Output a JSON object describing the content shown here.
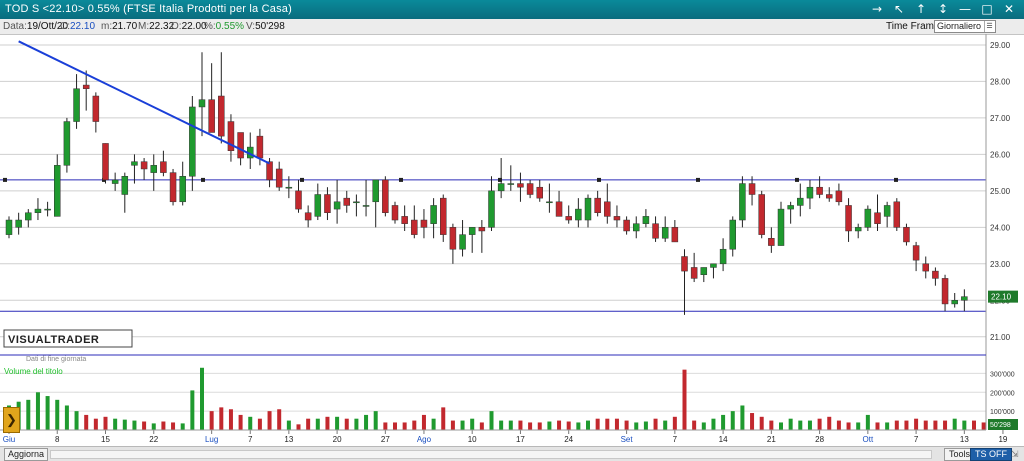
{
  "titlebar": {
    "title": "TOD S <22.10> 0.55%  (FTSE Italia Prodotti per la Casa)",
    "controls": [
      "→",
      "↖",
      "↑",
      "↕",
      "—",
      "□",
      "✕"
    ]
  },
  "info": {
    "date_label": "Data:",
    "date": "19/Ott/20",
    "close_label": "C:",
    "close": "22.10",
    "min_label": "m:",
    "min": "21.70",
    "max_label": "M:",
    "max": "22.32",
    "open_label": "O:",
    "open": "22.00",
    "pct_label": "%:",
    "pct": "0.55%",
    "vol_label": "V:",
    "vol": "50'298"
  },
  "timeframe": {
    "label": "Time Frame",
    "value": "Giornaliero"
  },
  "colors": {
    "up": "#1f9a2f",
    "down": "#c2282e",
    "trendline": "#1a3fd8",
    "level": "#2b2bb8",
    "volume_label": "#1fbf2a",
    "price_badge": "#1f7a2b"
  },
  "watermark": {
    "brand": "VISUALTRADER",
    "note": "Dati di fine giornata"
  },
  "volume_panel": {
    "label": "Volume del titolo",
    "last_value": "50'298"
  },
  "bottombar": {
    "refresh": "Aggiorna",
    "tools": "Tools",
    "ts": "TS OFF"
  },
  "chart_data": [
    {
      "type": "candlestick",
      "title": "",
      "ylim": [
        20.5,
        29.3
      ],
      "yticks": [
        "29.00",
        "28.00",
        "27.00",
        "26.00",
        "25.00",
        "24.00",
        "23.00",
        "22.00",
        "21.00"
      ],
      "last_price": "22.10",
      "x_ticks": [
        "Giu",
        "8",
        "15",
        "22",
        "Lug",
        "7",
        "13",
        "20",
        "27",
        "Ago",
        "10",
        "17",
        "24",
        "Set",
        "7",
        "14",
        "21",
        "28",
        "Ott",
        "7",
        "13",
        "19"
      ],
      "x_tick_index": [
        0,
        5,
        10,
        15,
        21,
        25,
        29,
        34,
        39,
        43,
        48,
        53,
        58,
        64,
        69,
        74,
        79,
        84,
        89,
        94,
        99,
        103
      ],
      "horizontal_levels": [
        25.3,
        21.7
      ],
      "trendline": {
        "from": {
          "index": 1,
          "price": 29.1
        },
        "to": {
          "index": 27,
          "price": 25.75
        }
      },
      "candles": [
        {
          "o": 23.8,
          "h": 24.3,
          "l": 23.7,
          "c": 24.2
        },
        {
          "o": 24.0,
          "h": 24.4,
          "l": 23.8,
          "c": 24.2
        },
        {
          "o": 24.2,
          "h": 24.5,
          "l": 24.0,
          "c": 24.4
        },
        {
          "o": 24.4,
          "h": 24.8,
          "l": 24.2,
          "c": 24.5
        },
        {
          "o": 24.5,
          "h": 24.7,
          "l": 24.3,
          "c": 24.5
        },
        {
          "o": 24.3,
          "h": 26.0,
          "l": 24.3,
          "c": 25.7
        },
        {
          "o": 25.7,
          "h": 27.0,
          "l": 25.5,
          "c": 26.9
        },
        {
          "o": 26.9,
          "h": 28.2,
          "l": 26.7,
          "c": 27.8
        },
        {
          "o": 27.9,
          "h": 28.3,
          "l": 27.2,
          "c": 27.8
        },
        {
          "o": 27.6,
          "h": 27.7,
          "l": 26.6,
          "c": 26.9
        },
        {
          "o": 26.3,
          "h": 26.3,
          "l": 25.2,
          "c": 25.3
        },
        {
          "o": 25.2,
          "h": 25.5,
          "l": 25.0,
          "c": 25.3
        },
        {
          "o": 24.9,
          "h": 25.5,
          "l": 24.4,
          "c": 25.4
        },
        {
          "o": 25.7,
          "h": 26.0,
          "l": 25.2,
          "c": 25.8
        },
        {
          "o": 25.8,
          "h": 25.9,
          "l": 25.3,
          "c": 25.6
        },
        {
          "o": 25.5,
          "h": 26.0,
          "l": 25.0,
          "c": 25.7
        },
        {
          "o": 25.8,
          "h": 26.1,
          "l": 25.4,
          "c": 25.5
        },
        {
          "o": 25.5,
          "h": 25.6,
          "l": 24.6,
          "c": 24.7
        },
        {
          "o": 24.7,
          "h": 25.8,
          "l": 24.6,
          "c": 25.4
        },
        {
          "o": 25.4,
          "h": 27.6,
          "l": 25.0,
          "c": 27.3
        },
        {
          "o": 27.3,
          "h": 28.8,
          "l": 26.5,
          "c": 27.5
        },
        {
          "o": 27.5,
          "h": 28.5,
          "l": 26.7,
          "c": 26.6
        },
        {
          "o": 27.6,
          "h": 28.8,
          "l": 26.3,
          "c": 26.5
        },
        {
          "o": 26.9,
          "h": 27.1,
          "l": 25.8,
          "c": 26.1
        },
        {
          "o": 26.6,
          "h": 26.6,
          "l": 25.7,
          "c": 25.9
        },
        {
          "o": 25.9,
          "h": 26.6,
          "l": 25.6,
          "c": 26.2
        },
        {
          "o": 26.5,
          "h": 26.7,
          "l": 25.7,
          "c": 25.9
        },
        {
          "o": 25.8,
          "h": 25.9,
          "l": 25.1,
          "c": 25.3
        },
        {
          "o": 25.6,
          "h": 25.8,
          "l": 25.0,
          "c": 25.1
        },
        {
          "o": 25.1,
          "h": 25.4,
          "l": 24.8,
          "c": 25.1
        },
        {
          "o": 25.0,
          "h": 25.3,
          "l": 24.4,
          "c": 24.5
        },
        {
          "o": 24.4,
          "h": 24.6,
          "l": 24.0,
          "c": 24.2
        },
        {
          "o": 24.3,
          "h": 25.2,
          "l": 24.2,
          "c": 24.9
        },
        {
          "o": 24.9,
          "h": 25.1,
          "l": 24.2,
          "c": 24.4
        },
        {
          "o": 24.5,
          "h": 25.3,
          "l": 24.1,
          "c": 24.7
        },
        {
          "o": 24.8,
          "h": 25.0,
          "l": 24.4,
          "c": 24.6
        },
        {
          "o": 24.7,
          "h": 24.9,
          "l": 24.3,
          "c": 24.7
        },
        {
          "o": 24.6,
          "h": 25.3,
          "l": 24.3,
          "c": 24.6
        },
        {
          "o": 24.7,
          "h": 25.0,
          "l": 24.0,
          "c": 25.3
        },
        {
          "o": 25.3,
          "h": 25.4,
          "l": 24.3,
          "c": 24.4
        },
        {
          "o": 24.6,
          "h": 24.7,
          "l": 24.1,
          "c": 24.2
        },
        {
          "o": 24.3,
          "h": 24.6,
          "l": 23.9,
          "c": 24.1
        },
        {
          "o": 24.2,
          "h": 24.6,
          "l": 23.7,
          "c": 23.8
        },
        {
          "o": 24.2,
          "h": 24.5,
          "l": 23.7,
          "c": 24.0
        },
        {
          "o": 24.1,
          "h": 24.8,
          "l": 23.7,
          "c": 24.6
        },
        {
          "o": 24.8,
          "h": 24.9,
          "l": 23.6,
          "c": 23.8
        },
        {
          "o": 24.0,
          "h": 24.1,
          "l": 23.0,
          "c": 23.4
        },
        {
          "o": 23.4,
          "h": 24.2,
          "l": 23.2,
          "c": 23.8
        },
        {
          "o": 23.8,
          "h": 24.0,
          "l": 23.3,
          "c": 24.0
        },
        {
          "o": 24.0,
          "h": 24.2,
          "l": 23.3,
          "c": 23.9
        },
        {
          "o": 24.0,
          "h": 25.4,
          "l": 23.9,
          "c": 25.0
        },
        {
          "o": 25.0,
          "h": 25.9,
          "l": 24.8,
          "c": 25.2
        },
        {
          "o": 25.2,
          "h": 25.7,
          "l": 25.0,
          "c": 25.2
        },
        {
          "o": 25.2,
          "h": 25.5,
          "l": 24.7,
          "c": 25.1
        },
        {
          "o": 25.2,
          "h": 25.3,
          "l": 24.8,
          "c": 24.9
        },
        {
          "o": 25.1,
          "h": 25.3,
          "l": 24.7,
          "c": 24.8
        },
        {
          "o": 24.7,
          "h": 25.2,
          "l": 24.4,
          "c": 24.7
        },
        {
          "o": 24.7,
          "h": 25.0,
          "l": 24.3,
          "c": 24.3
        },
        {
          "o": 24.3,
          "h": 24.6,
          "l": 24.1,
          "c": 24.2
        },
        {
          "o": 24.2,
          "h": 24.8,
          "l": 24.0,
          "c": 24.5
        },
        {
          "o": 24.2,
          "h": 24.9,
          "l": 24.0,
          "c": 24.8
        },
        {
          "o": 24.8,
          "h": 25.0,
          "l": 24.3,
          "c": 24.4
        },
        {
          "o": 24.7,
          "h": 25.2,
          "l": 24.1,
          "c": 24.3
        },
        {
          "o": 24.3,
          "h": 24.6,
          "l": 24.0,
          "c": 24.2
        },
        {
          "o": 24.2,
          "h": 24.3,
          "l": 23.8,
          "c": 23.9
        },
        {
          "o": 23.9,
          "h": 24.3,
          "l": 23.7,
          "c": 24.1
        },
        {
          "o": 24.1,
          "h": 24.5,
          "l": 24.0,
          "c": 24.3
        },
        {
          "o": 24.1,
          "h": 24.3,
          "l": 23.6,
          "c": 23.7
        },
        {
          "o": 23.7,
          "h": 24.3,
          "l": 23.6,
          "c": 24.0
        },
        {
          "o": 24.0,
          "h": 24.2,
          "l": 23.6,
          "c": 23.6
        },
        {
          "o": 23.2,
          "h": 23.4,
          "l": 21.6,
          "c": 22.8
        },
        {
          "o": 22.9,
          "h": 23.3,
          "l": 22.5,
          "c": 22.6
        },
        {
          "o": 22.7,
          "h": 22.9,
          "l": 22.5,
          "c": 22.9
        },
        {
          "o": 22.9,
          "h": 23.0,
          "l": 22.6,
          "c": 23.0
        },
        {
          "o": 23.0,
          "h": 23.7,
          "l": 22.8,
          "c": 23.4
        },
        {
          "o": 23.4,
          "h": 24.3,
          "l": 23.2,
          "c": 24.2
        },
        {
          "o": 24.2,
          "h": 25.4,
          "l": 24.0,
          "c": 25.2
        },
        {
          "o": 25.2,
          "h": 25.4,
          "l": 24.6,
          "c": 24.9
        },
        {
          "o": 24.9,
          "h": 25.0,
          "l": 23.7,
          "c": 23.8
        },
        {
          "o": 23.7,
          "h": 24.0,
          "l": 23.3,
          "c": 23.5
        },
        {
          "o": 23.5,
          "h": 24.7,
          "l": 23.5,
          "c": 24.5
        },
        {
          "o": 24.5,
          "h": 24.7,
          "l": 24.1,
          "c": 24.6
        },
        {
          "o": 24.6,
          "h": 25.2,
          "l": 24.3,
          "c": 24.8
        },
        {
          "o": 24.8,
          "h": 25.3,
          "l": 24.5,
          "c": 25.1
        },
        {
          "o": 25.1,
          "h": 25.4,
          "l": 24.8,
          "c": 24.9
        },
        {
          "o": 24.9,
          "h": 25.1,
          "l": 24.7,
          "c": 24.8
        },
        {
          "o": 25.0,
          "h": 25.2,
          "l": 24.6,
          "c": 24.7
        },
        {
          "o": 24.6,
          "h": 24.8,
          "l": 23.6,
          "c": 23.9
        },
        {
          "o": 23.9,
          "h": 24.1,
          "l": 23.7,
          "c": 24.0
        },
        {
          "o": 24.0,
          "h": 24.6,
          "l": 23.9,
          "c": 24.5
        },
        {
          "o": 24.4,
          "h": 24.9,
          "l": 23.9,
          "c": 24.1
        },
        {
          "o": 24.3,
          "h": 24.7,
          "l": 24.0,
          "c": 24.6
        },
        {
          "o": 24.7,
          "h": 24.8,
          "l": 23.9,
          "c": 24.0
        },
        {
          "o": 24.0,
          "h": 24.1,
          "l": 23.5,
          "c": 23.6
        },
        {
          "o": 23.5,
          "h": 23.6,
          "l": 22.8,
          "c": 23.1
        },
        {
          "o": 23.0,
          "h": 23.2,
          "l": 22.6,
          "c": 22.8
        },
        {
          "o": 22.8,
          "h": 22.9,
          "l": 22.4,
          "c": 22.6
        },
        {
          "o": 22.6,
          "h": 22.7,
          "l": 21.7,
          "c": 21.9
        },
        {
          "o": 21.9,
          "h": 22.2,
          "l": 21.8,
          "c": 22.0
        },
        {
          "o": 22.0,
          "h": 22.3,
          "l": 21.7,
          "c": 22.1
        }
      ]
    },
    {
      "type": "bar",
      "title": "Volume del titolo",
      "ylim": [
        0,
        350000
      ],
      "yticks": [
        "300'000",
        "200'000",
        "100'000"
      ],
      "values": [
        130000,
        150000,
        160000,
        200000,
        180000,
        160000,
        130000,
        100000,
        80000,
        60000,
        70000,
        60000,
        55000,
        50000,
        45000,
        35000,
        45000,
        40000,
        35000,
        210000,
        330000,
        100000,
        120000,
        110000,
        80000,
        70000,
        60000,
        100000,
        110000,
        50000,
        30000,
        60000,
        60000,
        70000,
        70000,
        60000,
        60000,
        80000,
        100000,
        40000,
        40000,
        40000,
        50000,
        80000,
        60000,
        120000,
        50000,
        50000,
        60000,
        40000,
        100000,
        50000,
        50000,
        50000,
        40000,
        40000,
        45000,
        50000,
        45000,
        40000,
        50000,
        60000,
        60000,
        60000,
        50000,
        40000,
        45000,
        60000,
        50000,
        70000,
        320000,
        50000,
        40000,
        60000,
        80000,
        100000,
        130000,
        90000,
        70000,
        50000,
        40000,
        60000,
        50000,
        50000,
        60000,
        70000,
        50000,
        40000,
        40000,
        80000,
        40000,
        40000,
        50000,
        50000,
        60000,
        50000,
        50000,
        50000,
        60000,
        50000,
        50000,
        40000,
        50298
      ]
    }
  ]
}
